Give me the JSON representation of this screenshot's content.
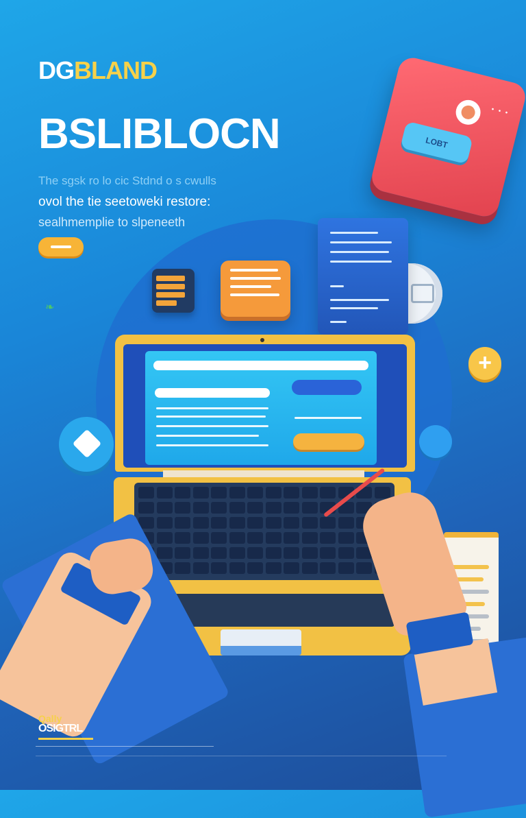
{
  "brand": {
    "part1": "DG",
    "part2": "BLAND"
  },
  "hero": {
    "title": "BSLIBLOCN",
    "line1": "The sgsk ro lo cic Stdnd o s cwulls",
    "line2": "ovol the tie seetoweki restore:",
    "line3": "sealhmemplie to  slpeneeth"
  },
  "phone": {
    "button_label": "LOBT",
    "menu": "• • •"
  },
  "footer": {
    "logo_top": "Qally",
    "logo_bottom": "OSIGTRL"
  },
  "colors": {
    "background": "#1a86d8",
    "accent_yellow": "#f2c144",
    "accent_orange": "#f59a3b",
    "accent_red": "#e2434f"
  },
  "icons": [
    "plus-icon",
    "diamond-icon",
    "leaf-icon",
    "camera-icon"
  ]
}
